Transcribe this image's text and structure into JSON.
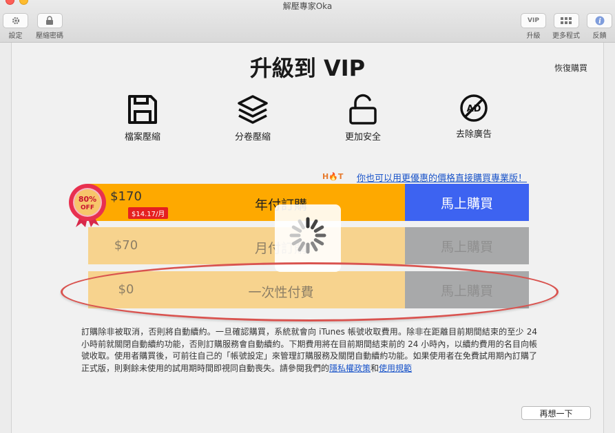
{
  "window": {
    "title": "解壓專家Oka"
  },
  "toolbar": {
    "settings": "設定",
    "password": "壓縮密碼",
    "upgrade": "升級",
    "upgrade_box": "VIP",
    "more_apps": "更多程式",
    "feedback": "反饋"
  },
  "page": {
    "title": "升級到 VIP",
    "restore": "恢復購買"
  },
  "features": [
    {
      "label": "檔案壓縮",
      "icon": "save-icon"
    },
    {
      "label": "分卷壓縮",
      "icon": "layers-icon"
    },
    {
      "label": "更加安全",
      "icon": "unlock-icon"
    },
    {
      "label": "去除廣告",
      "icon": "no-ad-icon"
    }
  ],
  "promo": {
    "hot": "H🔥T",
    "text": "你也可以用更優惠的價格直接購買專業版！"
  },
  "badge": {
    "percent": "80%",
    "off": "OFF"
  },
  "plans": [
    {
      "price": "$170",
      "monthly": "$14.17/月",
      "name": "年付訂購",
      "buy": "馬上購買"
    },
    {
      "price": "$70",
      "name": "月付訂購",
      "buy": "馬上購買"
    },
    {
      "price": "$0",
      "name": "一次性付費",
      "buy": "馬上購買"
    }
  ],
  "legal": {
    "text": "訂購除非被取消，否則將自動續約。一旦確認購買，系統就會向 iTunes 帳號收取費用。除非在距離目前期間結束的至少 24 小時前就關閉自動續約功能，否則訂購服務會自動續約。下期費用將在目前期間結束前的 24 小時內，以續約費用的名目向帳號收取。使用者購買後，可前往自己的「帳號設定」來管理訂購服務及關閉自動續約功能。如果使用者在免費試用期內訂購了正式版，則剩餘未使用的試用期時間即視同自動喪失。請參閱我們的",
    "privacy": "隱私權政策",
    "and": "和",
    "terms": "使用規範"
  },
  "buttons": {
    "later": "再想一下"
  },
  "colors": {
    "orange": "#fea900",
    "blue": "#3d63f1",
    "pale": "#f7d38e",
    "gray": "#a8a9aa",
    "link": "#1a54c9",
    "oval": "#d9534f"
  }
}
